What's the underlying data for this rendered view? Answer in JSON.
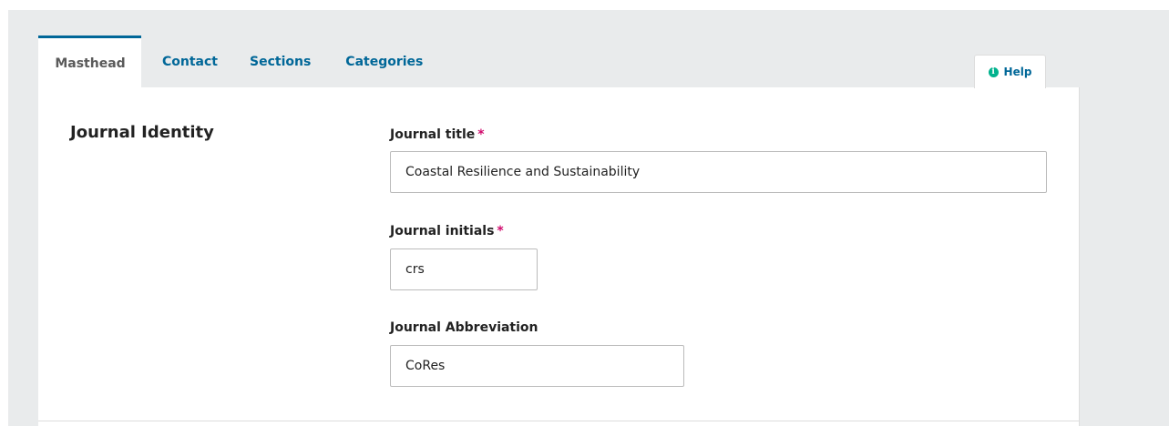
{
  "tabs": {
    "masthead": "Masthead",
    "contact": "Contact",
    "sections": "Sections",
    "categories": "Categories"
  },
  "help": {
    "label": "Help",
    "icon": "info-icon"
  },
  "form": {
    "section_title": "Journal Identity",
    "journal_title": {
      "label": "Journal title",
      "required_mark": "*",
      "value": "Coastal Resilience and Sustainability"
    },
    "journal_initials": {
      "label": "Journal initials",
      "required_mark": "*",
      "value": "crs"
    },
    "journal_abbreviation": {
      "label": "Journal Abbreviation",
      "value": "CoRes"
    }
  },
  "colors": {
    "link": "#006798",
    "required": "#d00a6c",
    "help_icon": "#00b28d",
    "background": "#e9ebec"
  }
}
